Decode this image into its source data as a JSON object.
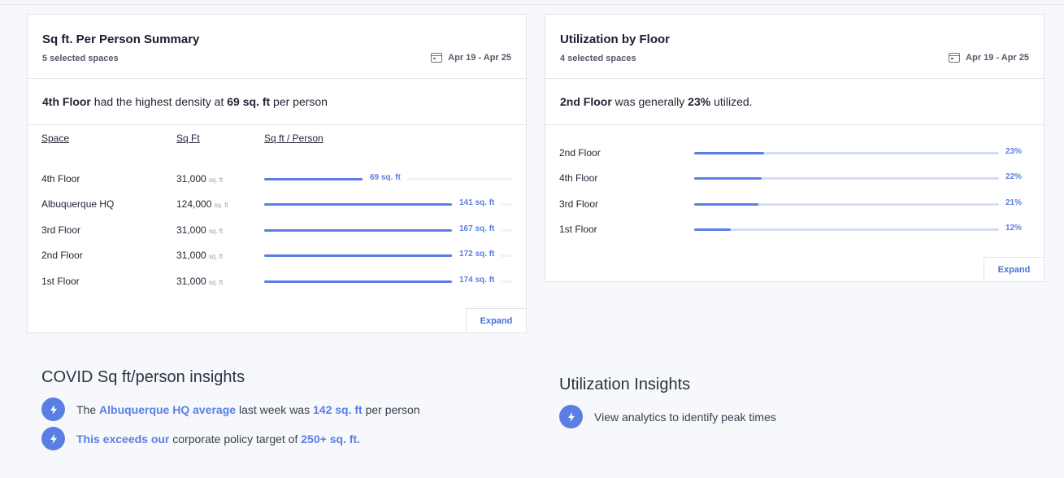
{
  "sqft_card": {
    "title": "Sq ft. Per Person Summary",
    "subtitle": "5 selected spaces",
    "date_range": "Apr 19  -  Apr 25",
    "summary": {
      "space": "4th Floor",
      "text1": " had the highest density at ",
      "value": "69 sq. ft",
      "text2": " per person"
    },
    "columns": [
      "Space",
      "Sq Ft",
      "Sq ft / Person"
    ],
    "unit": "sq. ft",
    "rows": [
      {
        "space": "4th Floor",
        "sqft": "31,000",
        "per_person": 69,
        "label": "69 sq. ft"
      },
      {
        "space": "Albuquerque HQ",
        "sqft": "124,000",
        "per_person": 141,
        "label": "141 sq. ft"
      },
      {
        "space": "3rd Floor",
        "sqft": "31,000",
        "per_person": 167,
        "label": "167 sq. ft"
      },
      {
        "space": "2nd Floor",
        "sqft": "31,000",
        "per_person": 172,
        "label": "172 sq. ft"
      },
      {
        "space": "1st Floor",
        "sqft": "31,000",
        "per_person": 174,
        "label": "174 sq. ft"
      }
    ],
    "expand_label": "Expand"
  },
  "util_card": {
    "title": "Utilization by Floor",
    "subtitle": "4 selected spaces",
    "date_range": "Apr 19  -  Apr 25",
    "summary": {
      "space": "2nd Floor",
      "text1": " was generally ",
      "value": "23%",
      "text2": " utilized."
    },
    "rows": [
      {
        "floor": "2nd Floor",
        "pct": 23,
        "label": "23%"
      },
      {
        "floor": "4th Floor",
        "pct": 22,
        "label": "22%"
      },
      {
        "floor": "3rd Floor",
        "pct": 21,
        "label": "21%"
      },
      {
        "floor": "1st Floor",
        "pct": 12,
        "label": "12%"
      }
    ],
    "expand_label": "Expand"
  },
  "covid_insights": {
    "title": "COVID Sq ft/person insights",
    "items": [
      {
        "t1": "The ",
        "h1": "Albuquerque HQ average",
        "t2": " last week was ",
        "h2": "142 sq. ft",
        "t3": " per person"
      },
      {
        "t1": "",
        "h1": "This exceeds our",
        "t2": " corporate policy target of ",
        "h2": "250+ sq. ft.",
        "t3": ""
      }
    ]
  },
  "util_insights": {
    "title": "Utilization Insights",
    "items": [
      {
        "text": "View analytics to identify peak times"
      }
    ]
  },
  "colors": {
    "accent": "#5b7ee5",
    "track_light": "#d2ddf6"
  },
  "icons": {
    "calendar": "calendar-icon",
    "insight": "lightning-bolt-icon"
  }
}
